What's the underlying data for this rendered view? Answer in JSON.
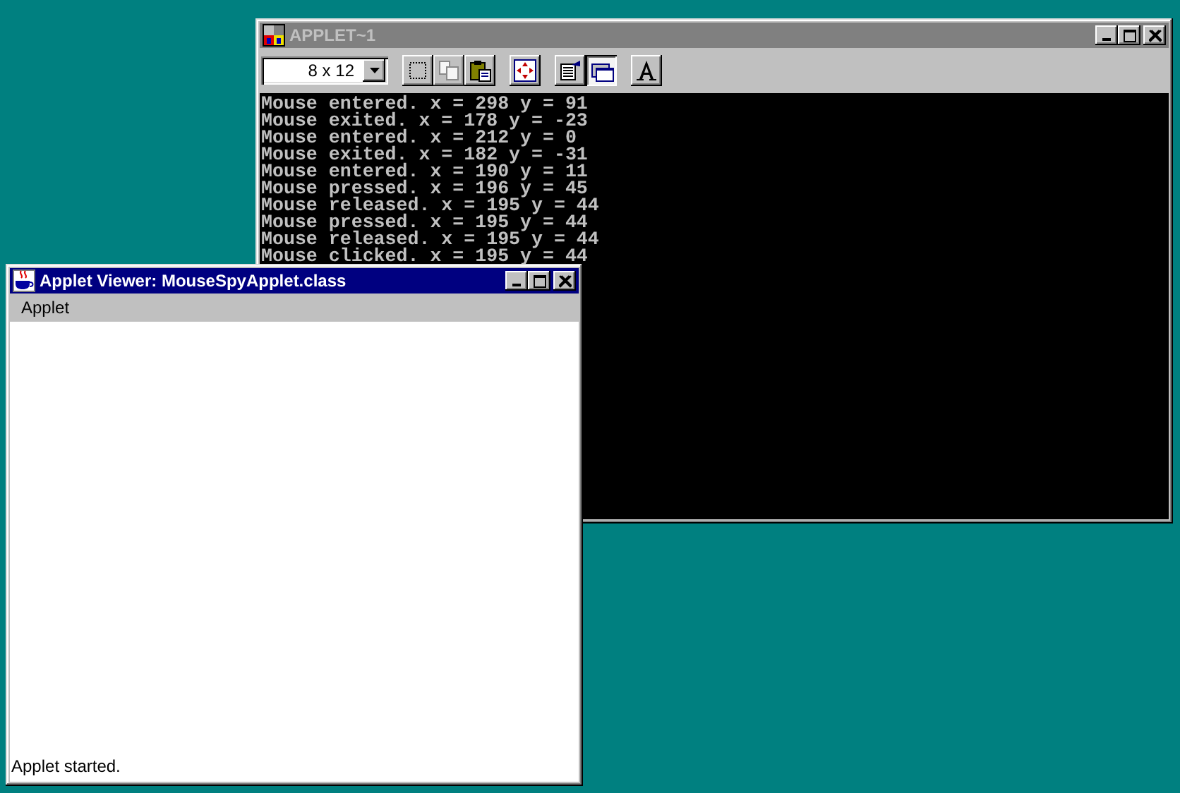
{
  "windows": [
    {
      "kind": "console",
      "title": "APPLET~1",
      "active": false,
      "font_size": "8 x 12",
      "toolbar": [
        {
          "kind": "mark",
          "disabled": false,
          "pressed": false
        },
        {
          "kind": "copy",
          "disabled": true,
          "pressed": false
        },
        {
          "kind": "paste",
          "disabled": false,
          "pressed": false
        },
        {
          "kind": "fullscreen",
          "disabled": false,
          "pressed": false
        },
        {
          "kind": "properties",
          "disabled": false,
          "pressed": false
        },
        {
          "kind": "background",
          "disabled": false,
          "pressed": true
        },
        {
          "kind": "font",
          "disabled": false,
          "pressed": false
        }
      ],
      "lines": [
        "Mouse entered. x = 298 y = 91",
        "Mouse exited. x = 178 y = -23",
        "Mouse entered. x = 212 y = 0",
        "Mouse exited. x = 182 y = -31",
        "Mouse entered. x = 190 y = 11",
        "Mouse pressed. x = 196 y = 45",
        "Mouse released. x = 195 y = 44",
        "Mouse pressed. x = 195 y = 44",
        "Mouse released. x = 195 y = 44",
        "Mouse clicked. x = 195 y = 44"
      ]
    },
    {
      "kind": "viewer",
      "title": "Applet Viewer: MouseSpyApplet.class",
      "active": true,
      "menu": [
        "Applet"
      ],
      "status": "Applet started."
    }
  ]
}
